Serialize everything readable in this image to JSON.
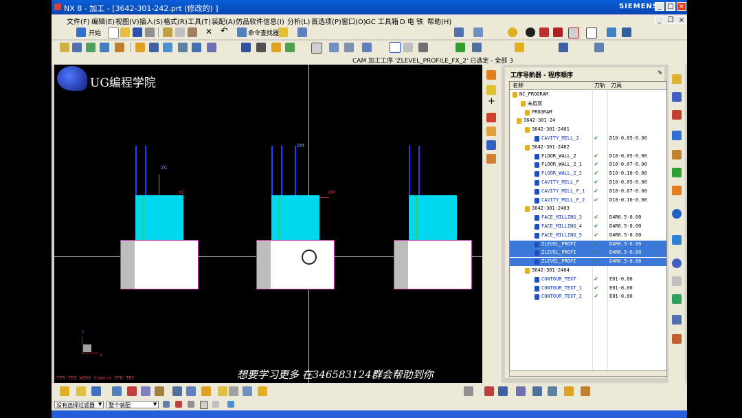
{
  "window": {
    "title": "NX 8 - 加工 - [3642-301-242.prt  (修改的) ]",
    "brand": "SIEMENS"
  },
  "menu": [
    "文件(F)",
    "编辑(E)",
    "视图(V)",
    "插入(S)",
    "格式(R)",
    "工具(T)",
    "装配(A)",
    "仿品软件",
    "信息(I)",
    "分析(L)",
    "首选项(P)",
    "窗口(O)",
    "GC 工具箱",
    "D 电",
    "铁",
    "帮助(H)"
  ],
  "toolbar": {
    "start_label": "开始",
    "cmd_finder_label": "命令查找器"
  },
  "status": {
    "text": "CAM 加工工序 'ZLEVEL_PROFILE_FX_2' 已选定 - 全部 3"
  },
  "viewport": {
    "logo_text": "UG编程学院",
    "promo_text": "想要学习更多 在346583124群会帮助到你",
    "view_label": "TFR-TRI WORK Camera TFR-TRI",
    "axes": {
      "xc": "XC",
      "zc": "ZC",
      "xm": "XM",
      "zm": "ZM",
      "x": "X",
      "y": "Y"
    }
  },
  "navigator": {
    "title": "工序导航器 - 程序顺序",
    "columns": [
      "名称",
      "刀轨",
      "刀具"
    ],
    "rows": [
      {
        "name": "NC_PROGRAM",
        "check": "",
        "tool": ""
      },
      {
        "name": "未用项",
        "check": "",
        "tool": ""
      },
      {
        "name": "PROGRAM",
        "check": "",
        "tool": ""
      },
      {
        "name": "3642-301-24",
        "check": "",
        "tool": ""
      },
      {
        "name": "3642-301-2401",
        "check": "",
        "tool": ""
      },
      {
        "name": "CAVITY_MILL_2",
        "check": "✔",
        "tool": "D10-0.05-0.00"
      },
      {
        "name": "3642-301-2402",
        "check": "",
        "tool": ""
      },
      {
        "name": "FLOOR_WALL_2",
        "check": "✔",
        "tool": "D10-0.05-0.00"
      },
      {
        "name": "FLOOR_WALL_2_1",
        "check": "✔",
        "tool": "D10-0.07-0.00"
      },
      {
        "name": "FLOOR_WALL_2_2",
        "check": "✔",
        "tool": "D10-0.10-0.00"
      },
      {
        "name": "CAVITY_MILL_F",
        "check": "✔",
        "tool": "D10-0.05-0.00"
      },
      {
        "name": "CAVITY_MILL_F_1",
        "check": "✔",
        "tool": "D10-0.07-0.00"
      },
      {
        "name": "CAVITY_MILL_F_2",
        "check": "✔",
        "tool": "D10-0.10-0.00"
      },
      {
        "name": "3642-301-2403",
        "check": "",
        "tool": ""
      },
      {
        "name": "FACE_MILLING_3",
        "check": "✔",
        "tool": "D4R0.5-0.00"
      },
      {
        "name": "FACE_MILLING_4",
        "check": "✔",
        "tool": "D4R0.5-0.00"
      },
      {
        "name": "FACE_MILLING_5",
        "check": "✔",
        "tool": "D4R0.5-0.00"
      },
      {
        "name": "ZLEVEL_PROFI",
        "check": "✔",
        "tool": "D4R0.5-0.00"
      },
      {
        "name": "ZLEVEL_PROFI",
        "check": "✔",
        "tool": "D4R0.5-0.00"
      },
      {
        "name": "ZLEVEL_PROFI",
        "check": "✔",
        "tool": "D4R0.5-0.00"
      },
      {
        "name": "3642-301-2404",
        "check": "",
        "tool": ""
      },
      {
        "name": "CONTOUR_TEXT",
        "check": "✔",
        "tool": "E01-0.00"
      },
      {
        "name": "CONTOUR_TEXT_1",
        "check": "✔",
        "tool": "E01-0.00"
      },
      {
        "name": "CONTOUR_TEXT_2",
        "check": "✔",
        "tool": "E01-0.00"
      }
    ]
  },
  "filter": {
    "type_filter": "没有选择过滤器",
    "scope": "整个装配"
  },
  "colors": {
    "accent": "#0a5fd8",
    "selection": "#3c78d8",
    "part_cyan": "#00d8f0",
    "check": "#1a9a1a"
  }
}
